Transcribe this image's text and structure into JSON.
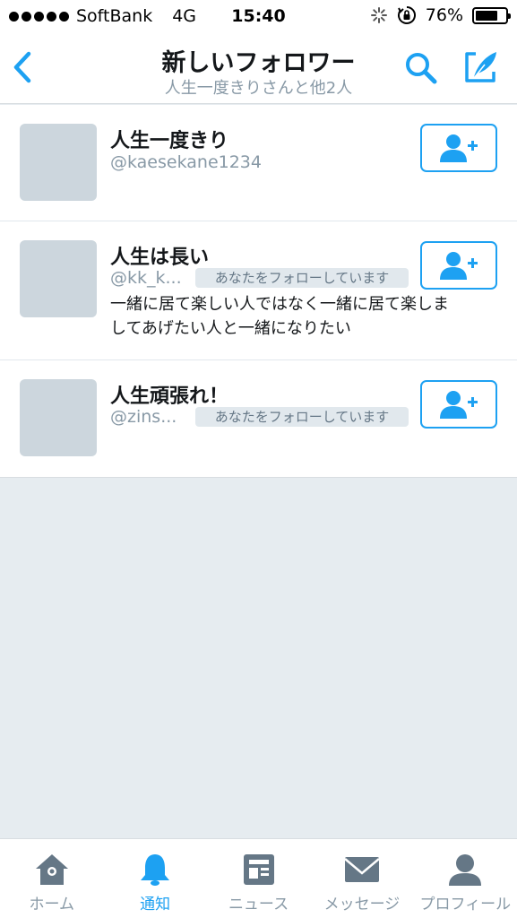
{
  "status_bar": {
    "carrier": "SoftBank",
    "network": "4G",
    "time": "15:40",
    "battery": "76%",
    "battery_level": 0.76
  },
  "header": {
    "title": "新しいフォロワー",
    "subtitle": "人生一度きりさんと他2人",
    "icons": [
      "back-chevron-icon",
      "search-icon",
      "compose-icon"
    ]
  },
  "followers": [
    {
      "name": "人生一度きり",
      "handle": "@kaesekane1234",
      "follows_you": "",
      "bio": ""
    },
    {
      "name": "人生は長い",
      "handle": "@kk_k...",
      "follows_you": "あなたをフォローしています",
      "bio_lines": [
        "一緒に居て楽しい人ではなく一緒に居て楽しま",
        "してあげたい人と一緒になりたい"
      ]
    },
    {
      "name": "人生頑張れ！",
      "handle": "@zins...",
      "follows_you": "あなたをフォローしています",
      "bio": ""
    }
  ],
  "tabs": [
    {
      "label": "ホーム",
      "icon": "home-icon"
    },
    {
      "label": "通知",
      "icon": "bell-icon",
      "active": true
    },
    {
      "label": "ニュース",
      "icon": "news-icon"
    },
    {
      "label": "メッセージ",
      "icon": "message-icon"
    },
    {
      "label": "プロフィール",
      "icon": "profile-icon"
    }
  ],
  "colors": {
    "accent": "#1da1f2",
    "muted": "#8899a6",
    "background": "#e6ecf0",
    "avatar_placeholder": "#ccd6dd"
  }
}
